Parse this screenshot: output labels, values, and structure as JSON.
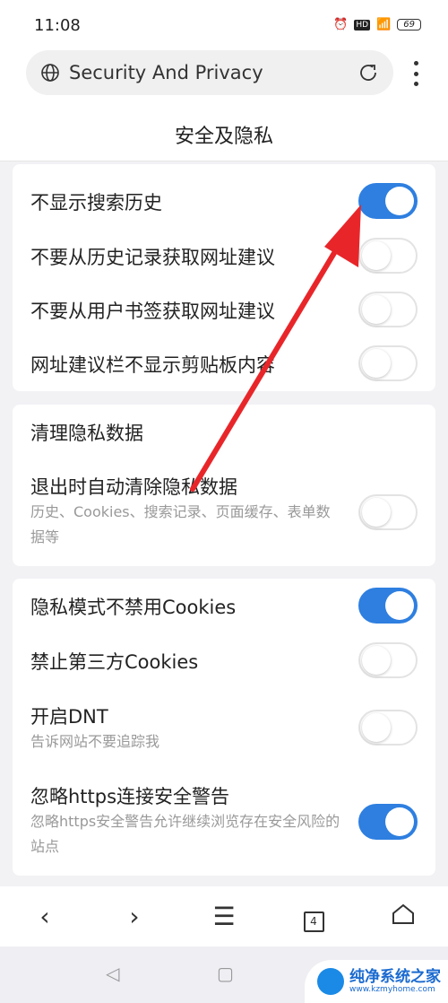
{
  "status": {
    "time": "11:08",
    "battery": "69",
    "icons": [
      "alarm-icon",
      "hd-icon",
      "wifi-icon",
      "5g-signal-icon",
      "battery-icon"
    ]
  },
  "urlbar": {
    "title": "Security And Privacy"
  },
  "page": {
    "title": "安全及隐私"
  },
  "card1": [
    {
      "label": "不显示搜索历史",
      "on": true
    },
    {
      "label": "不要从历史记录获取网址建议",
      "on": false
    },
    {
      "label": "不要从用户书签获取网址建议",
      "on": false
    },
    {
      "label": "网址建议栏不显示剪贴板内容",
      "on": false
    }
  ],
  "card2": {
    "header": "清理隐私数据",
    "item": {
      "label": "退出时自动清除隐私数据",
      "sub": "历史、Cookies、搜索记录、页面缓存、表单数据等",
      "on": false
    }
  },
  "card3": [
    {
      "label": "隐私模式不禁用Cookies",
      "on": true
    },
    {
      "label": "禁止第三方Cookies",
      "on": false
    },
    {
      "label": "开启DNT",
      "sub": "告诉网站不要追踪我",
      "on": false
    },
    {
      "label": "忽略https连接安全警告",
      "sub": "忽略https安全警告允许继续浏览存在安全风险的站点",
      "on": true
    }
  ],
  "bottom_nav": {
    "tab_count": "4"
  },
  "watermark": {
    "name": "纯净系统之家",
    "url": "www.kzmyhome.com"
  },
  "colors": {
    "accent": "#2e7fe0",
    "arrow": "#e8262a"
  }
}
